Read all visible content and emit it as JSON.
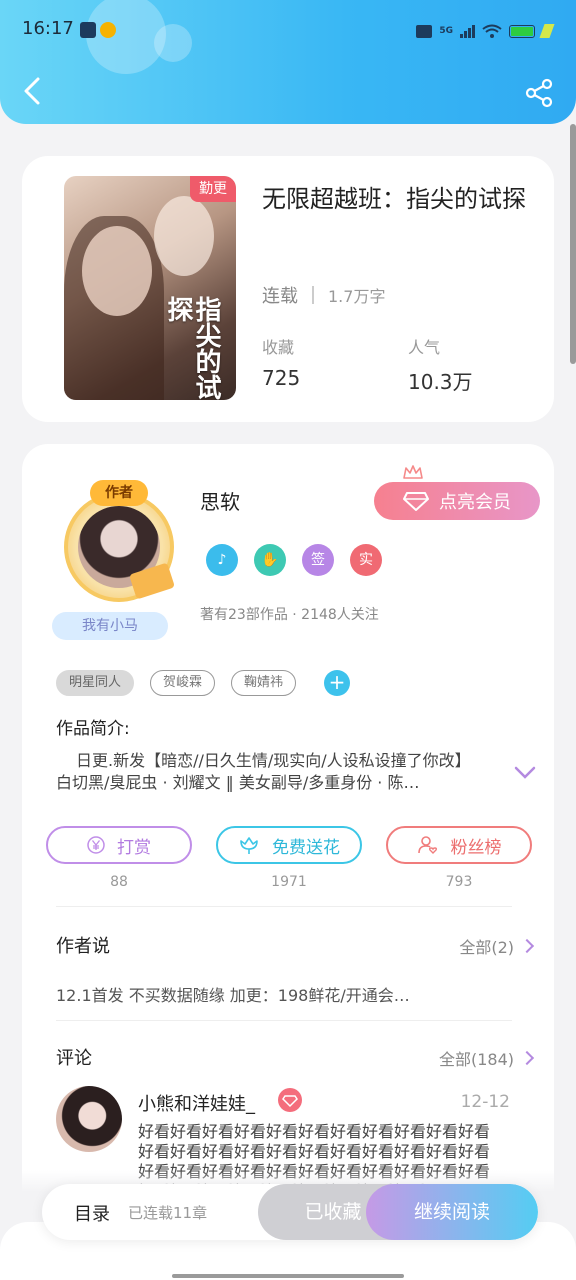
{
  "status_bar": {
    "time": "16:17",
    "network": "5G",
    "notification_icons": [
      "taobao-icon",
      "weibo-icon"
    ]
  },
  "header": {
    "back_icon": "chevron-left-icon",
    "share_icon": "share-icon"
  },
  "book": {
    "cover_title": "指尖的试探",
    "badge": "勤更",
    "title": "无限超越班：指尖的试探",
    "status": "连载",
    "words": "1.7万字",
    "stats": [
      {
        "label": "收藏",
        "value": "725"
      },
      {
        "label": "人气",
        "value": "10.3万"
      }
    ]
  },
  "author": {
    "avatar_tag": "作者",
    "avatar_name": "我有小马",
    "name": "思软",
    "vip_button": "点亮会员",
    "badges": [
      {
        "icon": "music-note-icon",
        "text": "",
        "color": "#3bbcec"
      },
      {
        "icon": "handshake-icon",
        "text": "",
        "color": "#3ec9b3"
      },
      {
        "icon": "",
        "text": "签",
        "color": "#b786e6"
      },
      {
        "icon": "",
        "text": "实",
        "color": "#f06a73"
      }
    ],
    "works_info": "著有23部作品 · 2148人关注"
  },
  "tags": [
    "明星同人",
    "贺峻霖",
    "鞠婧祎"
  ],
  "intro": {
    "label": "作品简介:",
    "text": "日更.新发【暗恋//日久生情/现实向/人设私设撞了你改】白切黑/臭屁虫 · 刘耀文 ‖ 美女副导/多重身份 · 陈…"
  },
  "actions": [
    {
      "label": "打赏",
      "count": "88",
      "icon": "yen-icon",
      "color": "#c08ee8"
    },
    {
      "label": "免费送花",
      "count": "1971",
      "icon": "flower-icon",
      "color": "#3cc6e6"
    },
    {
      "label": "粉丝榜",
      "count": "793",
      "icon": "fan-rank-icon",
      "color": "#f07c7c"
    }
  ],
  "author_says": {
    "title": "作者说",
    "more": "全部(2)",
    "text": "12.1首发 不买数据随缘 加更：198鲜花/开通会…"
  },
  "comments": {
    "title": "评论",
    "more": "全部(184)",
    "items": [
      {
        "user": "小熊和洋娃娃_",
        "date": "12-12",
        "text": "好看好看好看好看好看好看好看好看好看好看好看好看好看好看好看好看好看好看好看好看好看好看好看好看好看好看好看好看好看好看好看好看好看好看好看好看好看好看好看好看好看好看"
      }
    ]
  },
  "bottom_bar": {
    "toc": "目录",
    "chapters": "已连载11章",
    "fav": "已收藏",
    "read": "继续阅读"
  }
}
